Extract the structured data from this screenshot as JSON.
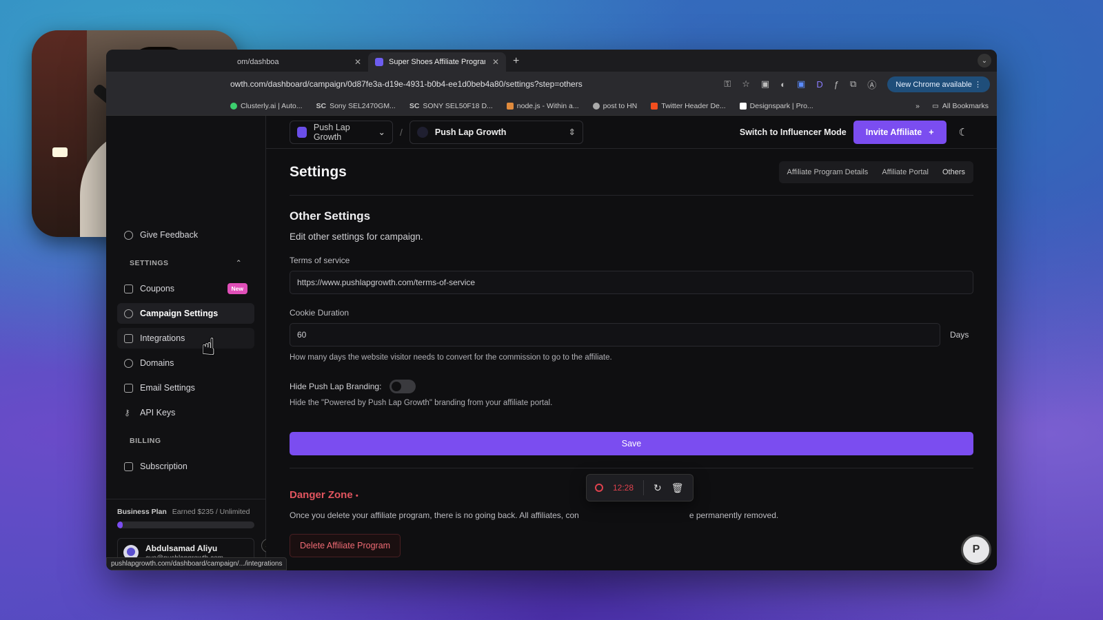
{
  "browser": {
    "tabs": [
      {
        "label": "om/dashboa",
        "active": false
      },
      {
        "label": "Super Shoes Affiliate Program",
        "active": true
      }
    ],
    "url": "owth.com/dashboard/campaign/0d87fe3a-d19e-4931-b0b4-ee1d0beb4a80/settings?step=others",
    "new_chrome": "New Chrome available",
    "bookmarks": [
      "Clusterly.ai | Auto...",
      "Sony SEL2470GM...",
      "SONY SEL50F18 D...",
      "node.js - Within a...",
      "post to HN",
      "Twitter Header De...",
      "Designspark | Pro..."
    ],
    "bookmark_prefixes": [
      "",
      "SC",
      "SC",
      "",
      "",
      "",
      ""
    ],
    "more": "»",
    "all_bookmarks": "All Bookmarks",
    "status_url": "pushlapgrowth.com/dashboard/campaign/.../integrations"
  },
  "topbar": {
    "workspace": "Push Lap Growth",
    "campaign": "Push Lap Growth",
    "switch_mode": "Switch to Influencer Mode",
    "invite": "Invite Affiliate",
    "invite_icon": "+"
  },
  "settings": {
    "title": "Settings",
    "subtabs": [
      "Affiliate Program Details",
      "Affiliate Portal",
      "Others"
    ],
    "section_title": "Other Settings",
    "section_sub": "Edit other settings for campaign.",
    "tos_label": "Terms of service",
    "tos_value": "https://www.pushlapgrowth.com/terms-of-service",
    "cookie_label": "Cookie Duration",
    "cookie_value": "60",
    "cookie_unit": "Days",
    "cookie_help": "How many days the website visitor needs to convert for the commission to go to the affiliate.",
    "branding_label": "Hide Push Lap Branding:",
    "branding_on": false,
    "branding_help": "Hide the \"Powered by Push Lap Growth\" branding from your affiliate portal.",
    "save": "Save",
    "danger_title": "Danger Zone",
    "danger_dot": "•",
    "danger_text_start": "Once you delete your affiliate program, there is no going back. All affiliates, con",
    "danger_text_end": "e permanently removed.",
    "delete": "Delete Affiliate Program"
  },
  "recorder": {
    "time": "12:28"
  },
  "chat_logo": "P",
  "sidebar": {
    "give_feedback": "Give Feedback",
    "settings_header": "SETTINGS",
    "items": [
      {
        "label": "Coupons",
        "badge": "New"
      },
      {
        "label": "Campaign Settings"
      },
      {
        "label": "Integrations"
      },
      {
        "label": "Domains"
      },
      {
        "label": "Email Settings"
      },
      {
        "label": "API Keys"
      }
    ],
    "billing_header": "BILLING",
    "subscription": "Subscription",
    "plan": "Business Plan",
    "earned": "Earned $235 / Unlimited",
    "plan_progress": 0.04,
    "user_name": "Abdulsamad Aliyu",
    "user_email": "ayo@pushlapgrowth.com"
  },
  "colors": {
    "accent": "#7b4df0",
    "danger": "#e2555f",
    "badge": "#e04fb8"
  }
}
